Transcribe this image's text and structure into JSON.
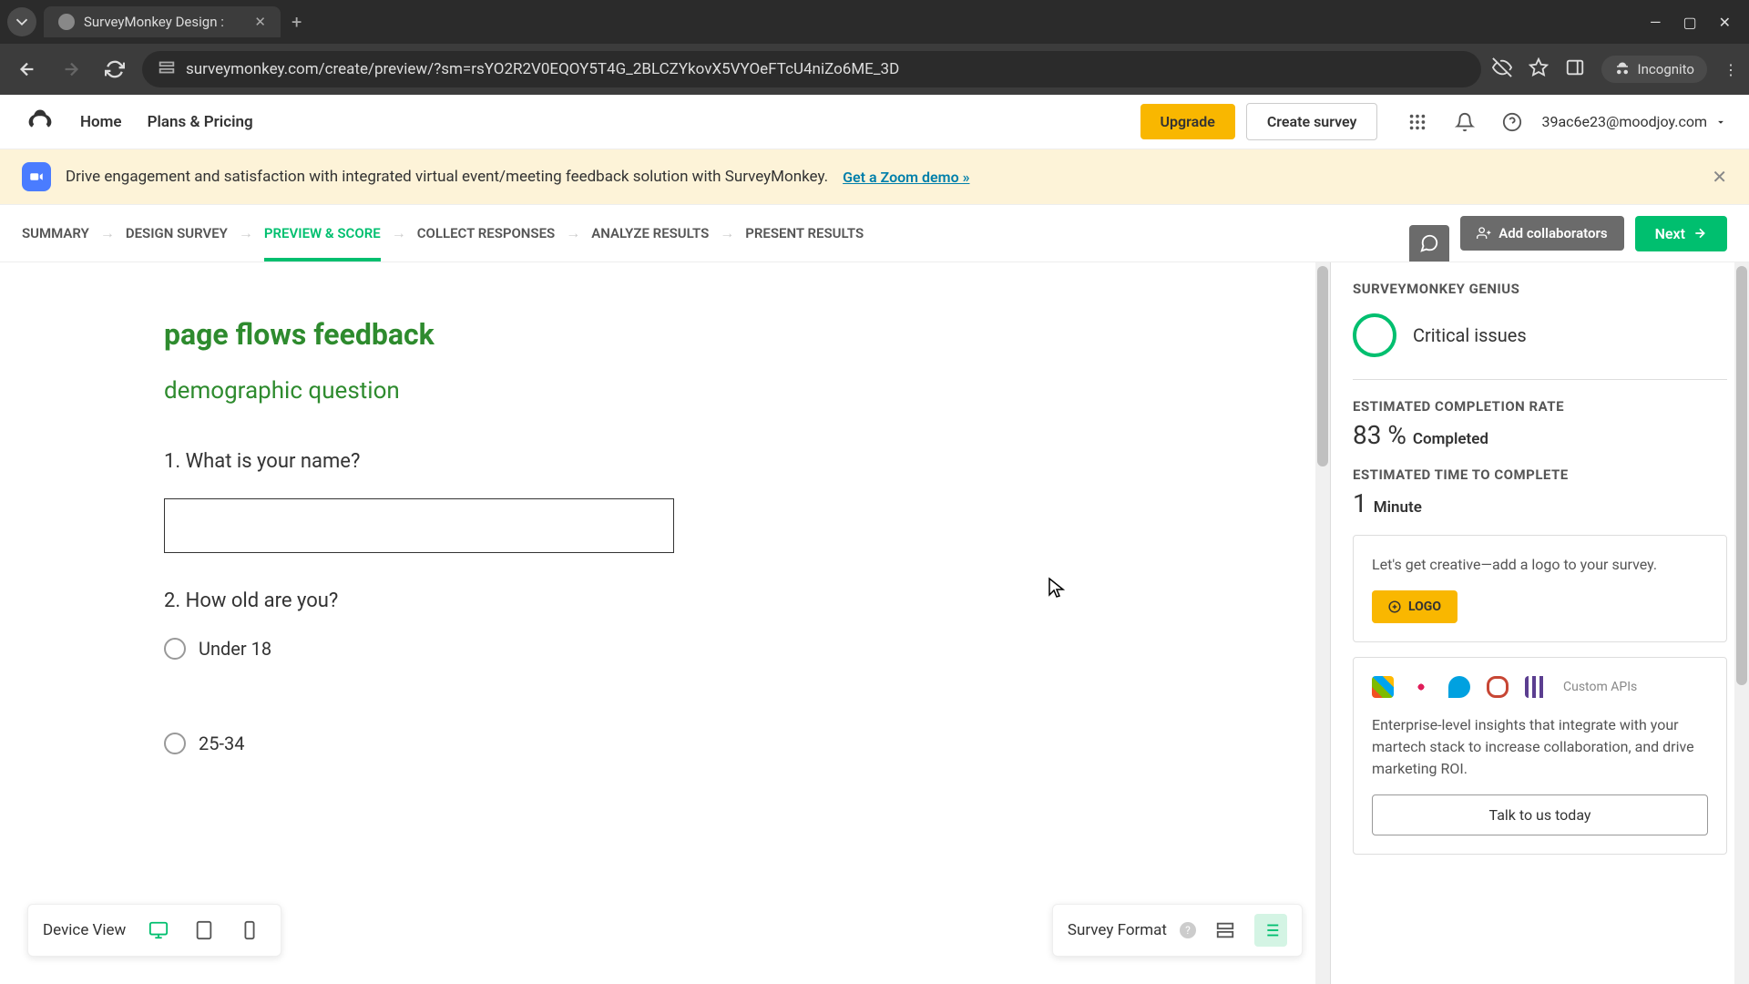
{
  "browser": {
    "tab_title": "SurveyMonkey Design :",
    "url": "surveymonkey.com/create/preview/?sm=rsYO2R2V0EQOY5T4G_2BLCZYkovX5VYOeFTcU4niZo6ME_3D",
    "incognito_label": "Incognito"
  },
  "nav": {
    "home": "Home",
    "plans": "Plans & Pricing",
    "upgrade": "Upgrade",
    "create": "Create survey",
    "user_email": "39ac6e23@moodjoy.com"
  },
  "promo": {
    "text": "Drive engagement and satisfaction with integrated virtual event/meeting feedback solution with SurveyMonkey.",
    "link": "Get a Zoom demo »"
  },
  "steps": {
    "summary": "SUMMARY",
    "design": "DESIGN SURVEY",
    "preview": "PREVIEW & SCORE",
    "collect": "COLLECT RESPONSES",
    "analyze": "ANALYZE RESULTS",
    "present": "PRESENT RESULTS",
    "collaborators": "Add collaborators",
    "next": "Next"
  },
  "survey": {
    "title": "page flows feedback",
    "subtitle": "demographic question",
    "q1": "1. What is your name?",
    "q2": "2. How old are you?",
    "opt1": "Under 18",
    "opt2": "25-34"
  },
  "device": {
    "label": "Device View"
  },
  "format": {
    "label": "Survey Format"
  },
  "panel": {
    "genius_header": "SURVEYMONKEY GENIUS",
    "critical": "Critical issues",
    "completion_label": "ESTIMATED COMPLETION RATE",
    "completion_pct": "83 %",
    "completion_suffix": "Completed",
    "time_label": "ESTIMATED TIME TO COMPLETE",
    "time_val": "1",
    "time_suffix": "Minute",
    "logo_text": "Let's get creative—add a logo to your survey.",
    "logo_btn": "LOGO",
    "custom_apis": "Custom APIs",
    "enterprise_text": "Enterprise-level insights that integrate with your martech stack to increase collaboration, and drive marketing ROI.",
    "talk_btn": "Talk to us today"
  }
}
